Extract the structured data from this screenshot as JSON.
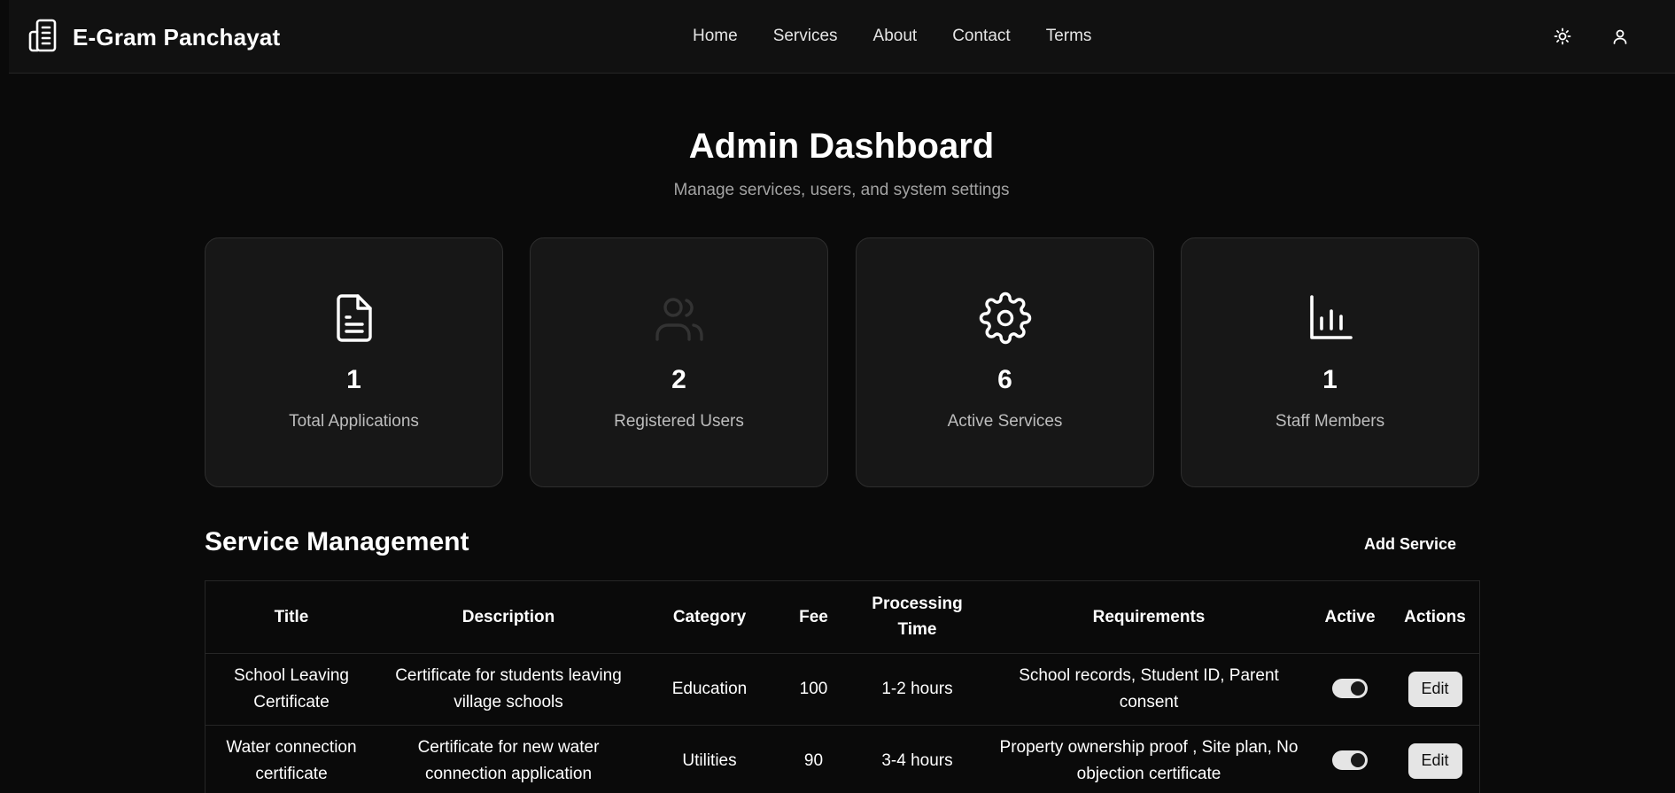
{
  "app": {
    "name": "E-Gram Panchayat"
  },
  "nav": {
    "links": [
      "Home",
      "Services",
      "About",
      "Contact",
      "Terms"
    ],
    "theme_icon": "sun-icon",
    "profile_icon": "user-icon"
  },
  "header": {
    "title": "Admin Dashboard",
    "subtitle": "Manage services, users, and system settings"
  },
  "stats": [
    {
      "value": "1",
      "label": "Total Applications",
      "icon": "file-text-icon"
    },
    {
      "value": "2",
      "label": "Registered Users",
      "icon": "users-icon"
    },
    {
      "value": "6",
      "label": "Active Services",
      "icon": "gear-icon"
    },
    {
      "value": "1",
      "label": "Staff Members",
      "icon": "bar-chart-icon"
    }
  ],
  "services": {
    "title": "Service Management",
    "add_label": "Add Service",
    "columns": [
      "Title",
      "Description",
      "Category",
      "Fee",
      "Processing Time",
      "Requirements",
      "Active",
      "Actions"
    ],
    "rows": [
      {
        "title": "School Leaving Certificate",
        "description": "Certificate for students leaving village schools",
        "category": "Education",
        "fee": "100",
        "processing_time": "1-2 hours",
        "requirements": "School records, Student ID, Parent consent",
        "active": true,
        "action_label": "Edit"
      },
      {
        "title": "Water connection certificate",
        "description": "Certificate for new water connection application",
        "category": "Utilities",
        "fee": "90",
        "processing_time": "3-4 hours",
        "requirements": "Property ownership proof , Site plan, No objection certificate",
        "active": true,
        "action_label": "Edit"
      }
    ]
  }
}
